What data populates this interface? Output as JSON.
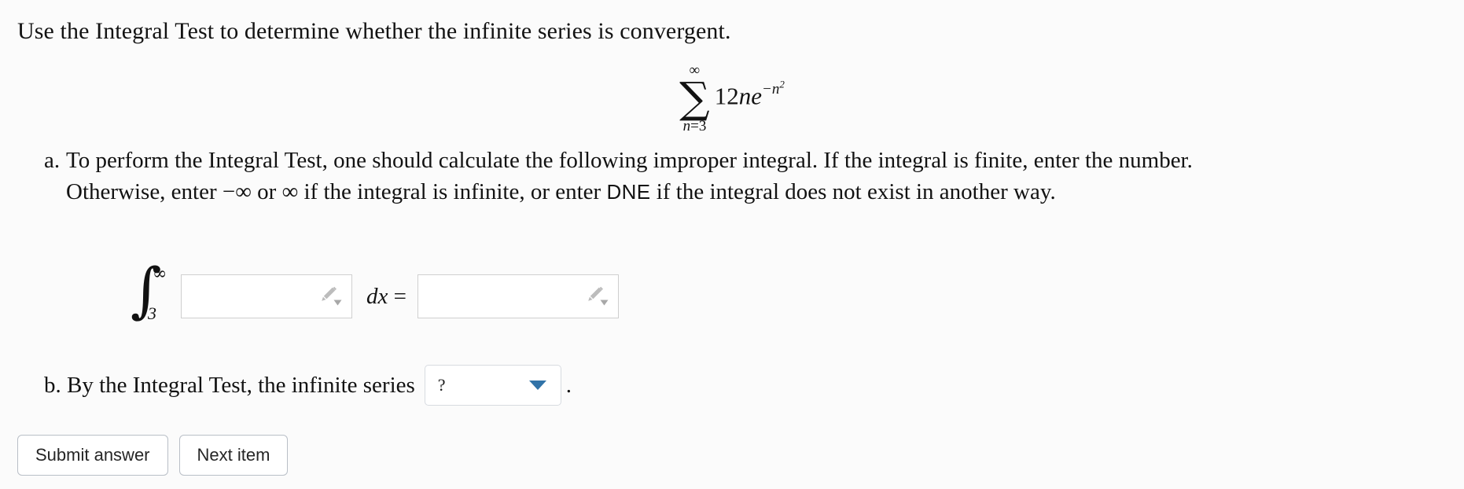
{
  "page": {
    "background_color": "#fbfbfb",
    "text_color": "#121212"
  },
  "prompt": {
    "text": "Use the Integral Test to determine whether the infinite series is convergent."
  },
  "formula": {
    "sigma": "∑",
    "upper_limit": "∞",
    "lower_index": "n",
    "lower_equals": "=",
    "lower_value": "3",
    "coefficient": "12",
    "variable": "n",
    "base": "e",
    "exponent_sign": "−",
    "exponent_var": "n",
    "exponent_power": "2",
    "plain": "∑ n=3 to ∞ of 12ne^(−n²)"
  },
  "part_a": {
    "marker": "a.",
    "line1": "To perform the Integral Test, one should calculate the following improper integral. If the integral is finite, enter the number.",
    "line2_before": "Otherwise, enter −∞ or ∞ if the integral is infinite, or enter ",
    "line2_dne": "DNE",
    "line2_after": " if the integral does not exist in another way.",
    "integral": {
      "symbol": "∫",
      "upper_limit": "∞",
      "lower_limit": "3",
      "integrand_value": "",
      "integrand_placeholder": "",
      "differential": "dx",
      "equals": "=",
      "result_value": "",
      "result_placeholder": "",
      "editor_icon": "pencil-dropdown-icon"
    }
  },
  "part_b": {
    "marker": "b.",
    "text": "By the Integral Test, the infinite series",
    "select_value": "?",
    "select_caret_color": "#3173a8",
    "trailing_period": "."
  },
  "buttons": {
    "submit_label": "Submit answer",
    "next_label": "Next item"
  }
}
